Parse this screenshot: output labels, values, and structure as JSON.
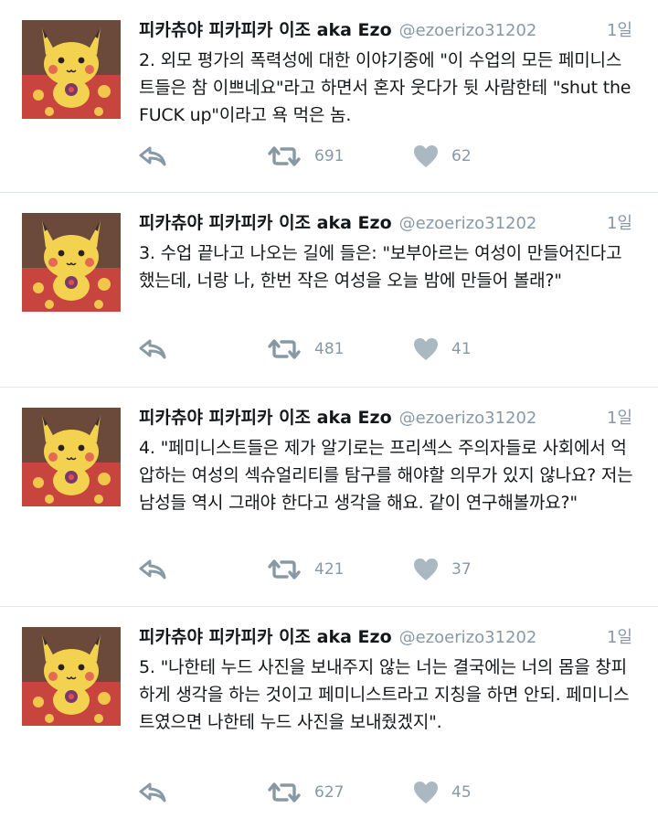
{
  "tweets": [
    {
      "name": "피카츄야 피카피카 이조 aka Ezo",
      "handle": "@ezoerizo31202",
      "time": "1일",
      "text": "2. 외모 평가의 폭력성에 대한 이야기중에 \"이 수업의 모든 페미니스트들은 참 이쁘네요\"라고 하면서 혼자 웃다가 뒷 사람한테 \"shut the FUCK up\"이라고 욕 먹은 놈.",
      "retweets": "691",
      "likes": "62"
    },
    {
      "name": "피카츄야 피카피카 이조 aka Ezo",
      "handle": "@ezoerizo31202",
      "time": "1일",
      "text": "3. 수업 끝나고 나오는 길에 들은: \"보부아르는 여성이 만들어진다고 했는데, 너랑 나, 한번 작은 여성을 오늘 밤에 만들어 볼래?\"",
      "retweets": "481",
      "likes": "41"
    },
    {
      "name": "피카츄야 피카피카 이조 aka Ezo",
      "handle": "@ezoerizo31202",
      "time": "1일",
      "text": "4. \"페미니스트들은 제가 알기로는 프리섹스 주의자들로 사회에서 억압하는 여성의 섹슈얼리티를 탐구를 해야할 의무가 있지 않나요? 저는 남성들 역시 그래야 한다고 생각을 해요. 같이 연구해볼까요?\"",
      "retweets": "421",
      "likes": "37"
    },
    {
      "name": "피카츄야 피카피카 이조 aka Ezo",
      "handle": "@ezoerizo31202",
      "time": "1일",
      "text": "5. \"나한테 누드 사진을 보내주지 않는 너는 결국에는 너의 몸을 창피하게 생각을 하는 것이고 페미니스트라고 지칭을 하면 안되. 페미니스트였으면 나한테 누드 사진을 보내줬겠지\".",
      "retweets": "627",
      "likes": "45"
    }
  ],
  "icons": {
    "reply": "reply-icon",
    "retweet": "retweet-icon",
    "like": "heart-icon",
    "avatar": "pikachu-avatar"
  },
  "colors": {
    "muted": "#8899a6",
    "text": "#14171a",
    "divider": "#e1e8ed"
  }
}
